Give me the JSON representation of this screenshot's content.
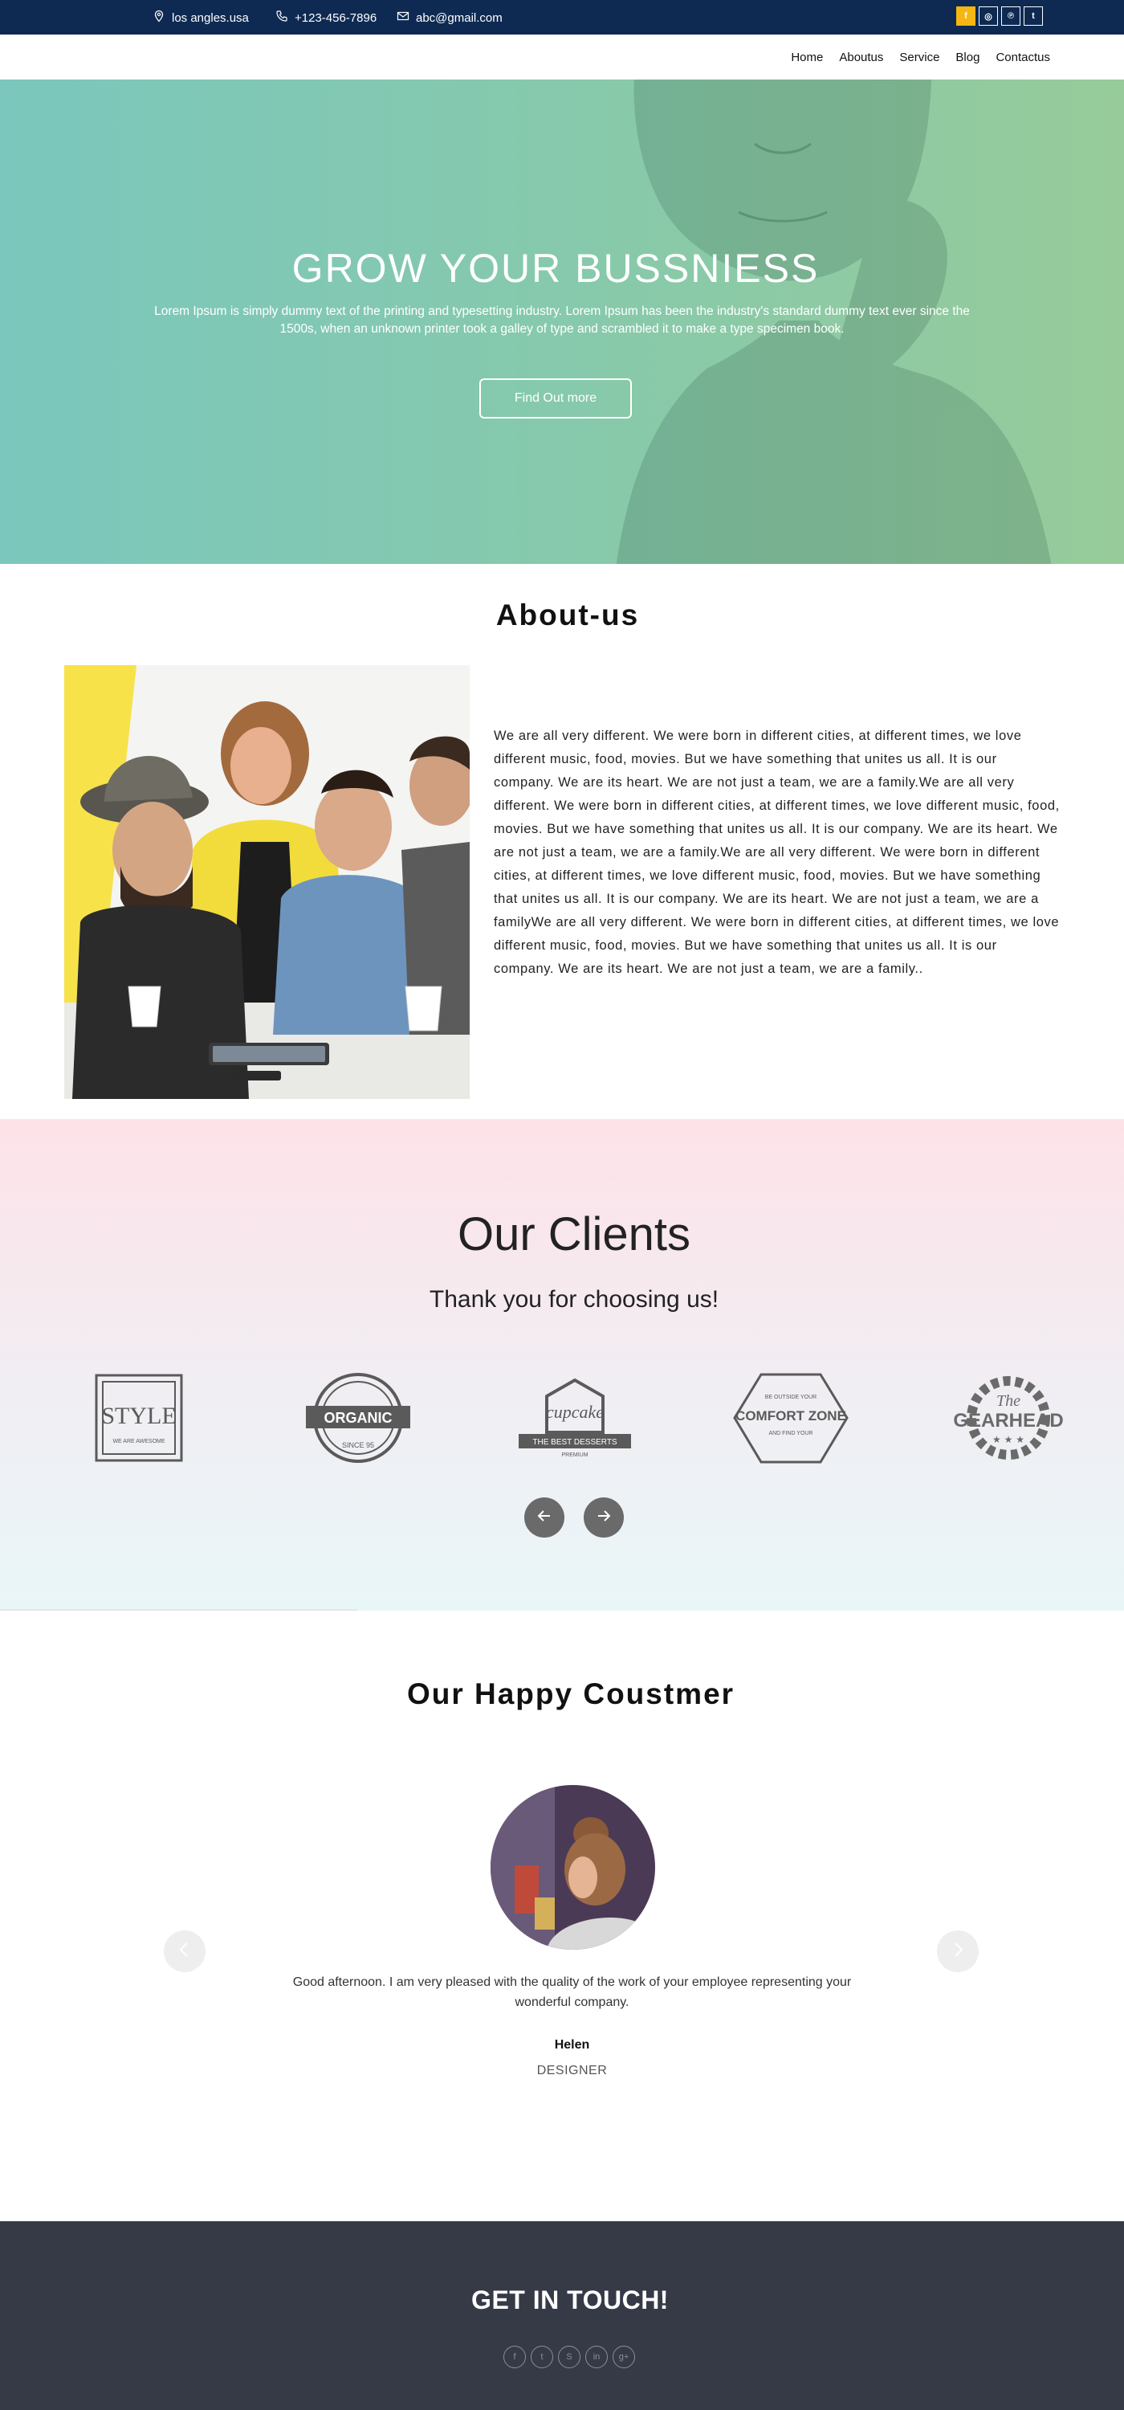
{
  "topbar": {
    "location": "los angles.usa",
    "phone": "+123-456-7896",
    "email": "abc@gmail.com",
    "social": [
      {
        "icon": "facebook-icon",
        "glyph": "f"
      },
      {
        "icon": "instagram-icon",
        "glyph": "◎"
      },
      {
        "icon": "pinterest-icon",
        "glyph": "℗"
      },
      {
        "icon": "twitter-icon",
        "glyph": "t"
      }
    ],
    "accent_color": "#f5b513",
    "background_color": "#0e2a52"
  },
  "nav": {
    "items": [
      "Home",
      "Aboutus",
      "Service",
      "Blog",
      "Contactus"
    ]
  },
  "hero": {
    "title": "GROW YOUR BUSSNIESS",
    "text": "Lorem Ipsum is simply dummy text of the printing and typesetting industry. Lorem Ipsum has been the industry's standard dummy text ever since the 1500s, when an unknown printer took a galley of type and scrambled it to make a type specimen book.",
    "button": "Find Out more"
  },
  "about": {
    "title": "About-us",
    "text": "We are all very different. We were born in different cities, at different times, we love different music, food, movies. But we have something that unites us all. It is our company. We are its heart. We are not just a team, we are a family.We are all very different. We were born in different cities, at different times, we love different music, food, movies. But we have something that unites us all. It is our company. We are its heart. We are not just a team, we are a family.We are all very different. We were born in different cities, at different times, we love different music, food, movies. But we have something that unites us all. It is our company. We are its heart. We are not just a team, we are a familyWe are all very different. We were born in different cities, at different times, we love different music, food, movies. But we have something that unites us all. It is our company. We are its heart. We are not just a team, we are a family.."
  },
  "clients": {
    "title": "Our Clients",
    "subtitle": "Thank you for choosing us!",
    "logos": {
      "style": {
        "main": "STYLE",
        "sub": "WE ARE AWESOME"
      },
      "organic": {
        "main": "ORGANIC",
        "sub": "SINCE 95"
      },
      "cupcake": {
        "main": "cupcake",
        "sub": "THE BEST DESSERTS",
        "tag": "PREMIUM"
      },
      "comfort": {
        "top": "BE OUTSIDE YOUR",
        "main": "COMFORT ZONE",
        "sub": "AND FIND YOUR"
      },
      "gearhead": {
        "top": "The",
        "main": "GEARHEAD"
      }
    }
  },
  "testimonials": {
    "title": "Our Happy Coustmer",
    "quote": "Good afternoon. I am very pleased with the quality of the work of your employee representing your wonderful company.",
    "name": "Helen",
    "role": "DESIGNER"
  },
  "footer": {
    "title": "GET IN TOUCH!",
    "social": [
      {
        "icon": "facebook-icon",
        "glyph": "f"
      },
      {
        "icon": "twitter-icon",
        "glyph": "t"
      },
      {
        "icon": "skype-icon",
        "glyph": "S"
      },
      {
        "icon": "linkedin-icon",
        "glyph": "in"
      },
      {
        "icon": "google-plus-icon",
        "glyph": "g+"
      }
    ],
    "background_color": "#363a47"
  }
}
